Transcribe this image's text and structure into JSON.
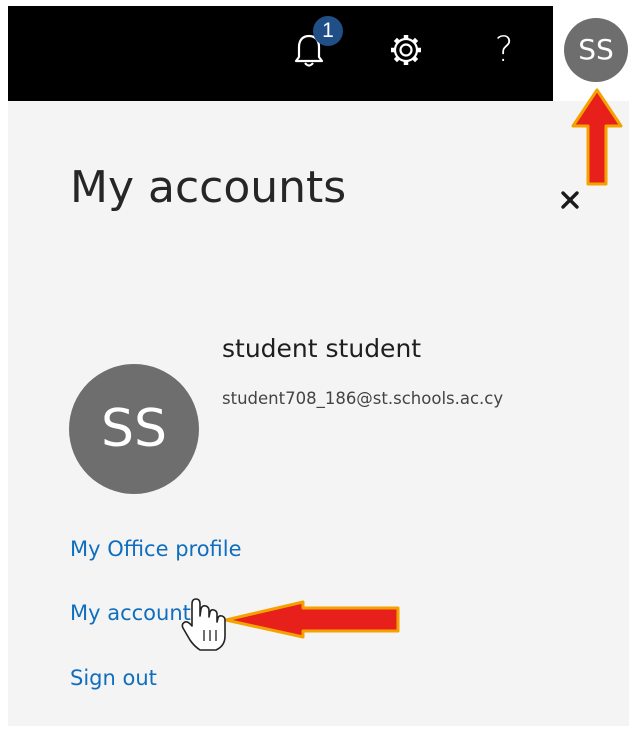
{
  "header": {
    "notifications_count": "1",
    "help_glyph": "?",
    "avatar_initials": "SS",
    "icons": {
      "notifications": "bell-icon",
      "settings": "gear-icon",
      "help": "question-icon"
    }
  },
  "panel": {
    "title": "My accounts",
    "close_icon": "close-icon",
    "user": {
      "initials": "SS",
      "name": "student student",
      "email": "student708_186@st.schools.ac.cy"
    },
    "links": {
      "office_profile": "My Office profile",
      "my_account": "My account",
      "sign_out": "Sign out"
    }
  },
  "colors": {
    "topbar_bg": "#000000",
    "panel_bg": "#f4f4f4",
    "avatar_bg": "#6e6e6e",
    "badge_bg": "#1f4f86",
    "link": "#106ebe",
    "annotation_arrow": "#e8201b",
    "annotation_outline": "#f5a200"
  }
}
